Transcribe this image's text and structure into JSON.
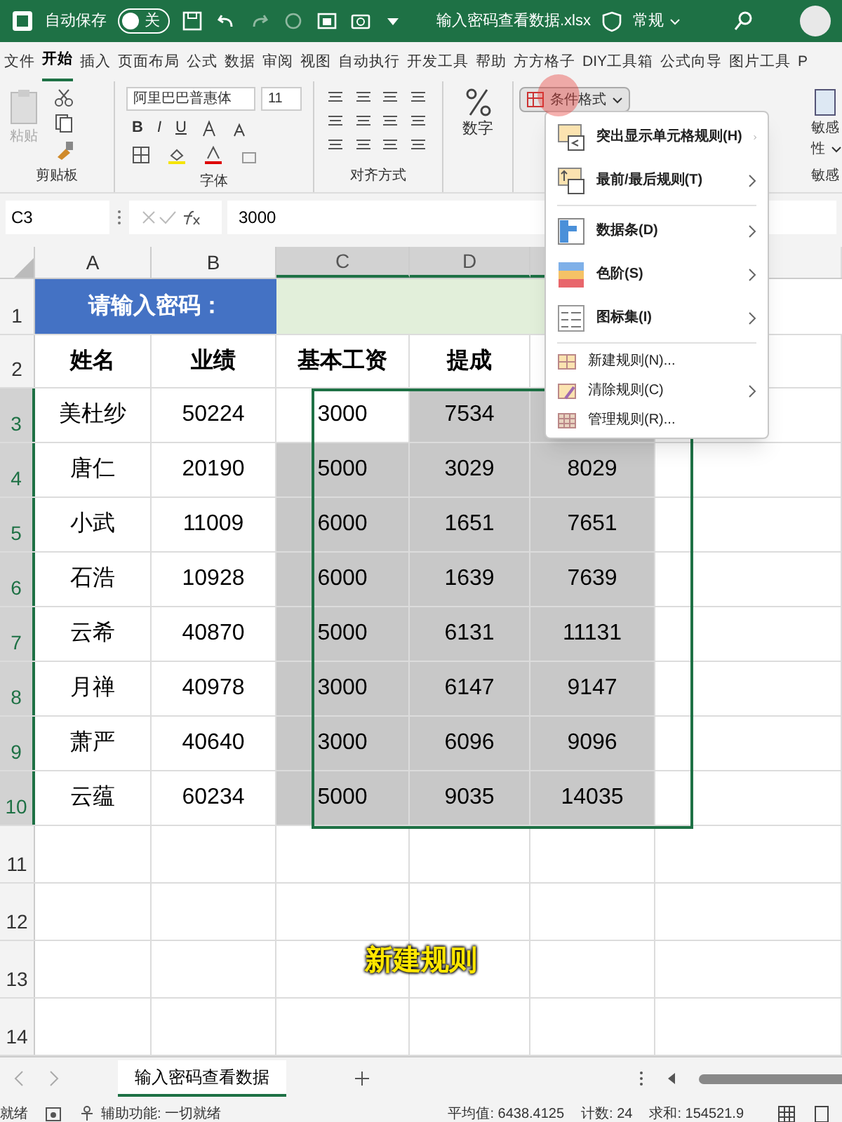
{
  "title_bar": {
    "autosave_label": "自动保存",
    "autosave": {
      "on": false,
      "label": "关"
    },
    "filename": "输入密码查看数据.xlsx",
    "sensitivity": "常规"
  },
  "tabs": [
    {
      "label": "文件",
      "selected": false
    },
    {
      "label": "开始",
      "selected": true
    },
    {
      "label": "插入",
      "selected": false
    },
    {
      "label": "页面布局",
      "selected": false
    },
    {
      "label": "公式",
      "selected": false
    },
    {
      "label": "数据",
      "selected": false
    },
    {
      "label": "审阅",
      "selected": false
    },
    {
      "label": "视图",
      "selected": false
    },
    {
      "label": "自动执行",
      "selected": false
    },
    {
      "label": "开发工具",
      "selected": false
    },
    {
      "label": "帮助",
      "selected": false
    },
    {
      "label": "方方格子",
      "selected": false
    },
    {
      "label": "DIY工具箱",
      "selected": false
    },
    {
      "label": "公式向导",
      "selected": false
    },
    {
      "label": "图片工具",
      "selected": false
    },
    {
      "label": "P",
      "selected": false
    }
  ],
  "ribbon": {
    "paste": "粘贴",
    "clipboard": "剪贴板",
    "font_name": "阿里巴巴普惠体",
    "font_size": "11",
    "bold": "B",
    "italic": "I",
    "underline": "U",
    "font": "字体",
    "alignment": "对齐方式",
    "number": "数字",
    "conditional_format": "条件格式",
    "sensitivity_button": "敏感",
    "sensitivity_button_2": "性",
    "sensitivity_group": "敏感"
  },
  "formula_bar": {
    "name_box": "C3",
    "value": "3000"
  },
  "columns": [
    {
      "letter": "A",
      "selected": false
    },
    {
      "letter": "B",
      "selected": false
    },
    {
      "letter": "C",
      "selected": true
    },
    {
      "letter": "D",
      "selected": true
    },
    {
      "selected": true
    }
  ],
  "rows": [
    {
      "number": "1",
      "kind": "prompt",
      "selected": false,
      "prompt": "请输入密码："
    },
    {
      "number": "2",
      "kind": "header",
      "selected": false,
      "cells": [
        "姓名",
        "业绩",
        "基本工资",
        "提成"
      ]
    },
    {
      "number": "3",
      "kind": "data",
      "selected": true,
      "cells": [
        "美杜纱",
        "50224",
        {
          "text": "3000",
          "active": true
        },
        "7534"
      ]
    },
    {
      "number": "4",
      "kind": "data",
      "selected": true,
      "cells": [
        "唐仁",
        "20190",
        "5000",
        "3029",
        "8029"
      ]
    },
    {
      "number": "5",
      "kind": "data",
      "selected": true,
      "cells": [
        "小武",
        "11009",
        "6000",
        "1651",
        "7651"
      ]
    },
    {
      "number": "6",
      "kind": "data",
      "selected": true,
      "cells": [
        "石浩",
        "10928",
        "6000",
        "1639",
        "7639"
      ]
    },
    {
      "number": "7",
      "kind": "data",
      "selected": true,
      "cells": [
        "云希",
        "40870",
        "5000",
        "6131",
        "11131"
      ]
    },
    {
      "number": "8",
      "kind": "data",
      "selected": true,
      "cells": [
        "月禅",
        "40978",
        "3000",
        "6147",
        "9147"
      ]
    },
    {
      "number": "9",
      "kind": "data",
      "selected": true,
      "cells": [
        "萧严",
        "40640",
        "3000",
        "6096",
        "9096"
      ]
    },
    {
      "number": "10",
      "kind": "data",
      "selected": true,
      "cells": [
        "云蕴",
        "60234",
        "5000",
        "9035",
        "14035"
      ]
    },
    {
      "number": "11",
      "kind": "empty",
      "selected": false
    },
    {
      "number": "12",
      "kind": "empty",
      "selected": false
    },
    {
      "number": "13",
      "kind": "empty",
      "selected": false
    },
    {
      "number": "14",
      "kind": "empty",
      "selected": false
    }
  ],
  "menu": [
    {
      "label": "突出显示单元格规则(H)",
      "kind": "highlight",
      "submenu": true
    },
    {
      "label": "最前/最后规则(T)",
      "kind": "topbottom",
      "submenu": true
    },
    {
      "label": "数据条(D)",
      "kind": "databar",
      "submenu": true
    },
    {
      "label": "色阶(S)",
      "kind": "colorscale",
      "submenu": true
    },
    {
      "label": "图标集(I)",
      "kind": "iconset",
      "submenu": true
    },
    {
      "label": "新建规则(N)...",
      "kind": "new",
      "submenu": false
    },
    {
      "label": "清除规则(C)",
      "kind": "clear",
      "submenu": true
    },
    {
      "label": "管理规则(R)...",
      "kind": "manage",
      "submenu": false
    }
  ],
  "caption": "新建规则",
  "sheet_tabs": [
    {
      "label": "输入密码查看数据",
      "selected": true
    }
  ],
  "status_bar": {
    "ready": "就绪",
    "accessibility": "辅助功能: 一切就绪",
    "average": "平均值: 6438.4125",
    "count": "计数: 24",
    "sum": "求和: 154521.9"
  }
}
